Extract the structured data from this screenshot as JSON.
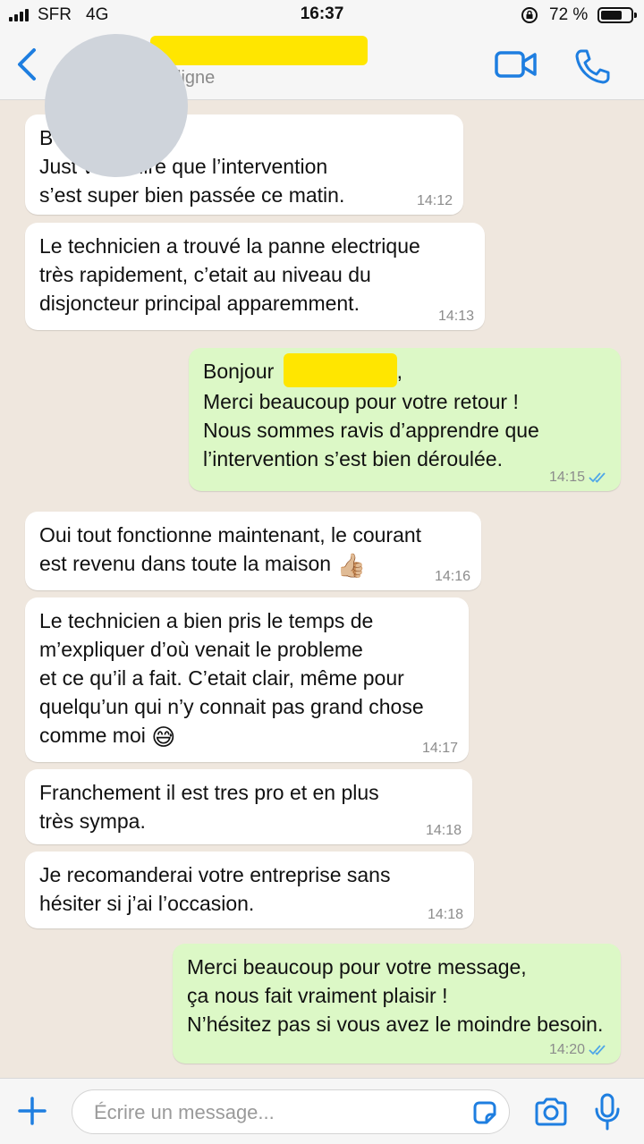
{
  "status_bar": {
    "carrier": "SFR",
    "network": "4G",
    "time": "16:37",
    "battery_percent": "72 %",
    "battery_level": 0.72
  },
  "header": {
    "contact_status": "ligne"
  },
  "messages": [
    {
      "direction": "in",
      "lines": [
        "B",
        "Just vous dire que l’intervention",
        "s’est super bien passée ce matin."
      ],
      "time": "14:12"
    },
    {
      "direction": "in",
      "lines": [
        "Le technicien a trouvé la panne electrique",
        "très rapidement, c’etait au niveau du",
        "disjoncteur principal apparemment."
      ],
      "time": "14:13"
    },
    {
      "direction": "out",
      "lines": [
        "Bonjour",
        ",",
        "Merci beaucoup pour votre retour !",
        "Nous sommes ravis d’apprendre que",
        "l’intervention s’est bien déroulée."
      ],
      "time": "14:15",
      "read": true
    },
    {
      "direction": "in",
      "lines": [
        "Oui tout fonctionne maintenant, le courant",
        "est revenu dans toute la maison"
      ],
      "emoji": "👍🏼",
      "time": "14:16"
    },
    {
      "direction": "in",
      "lines": [
        "Le technicien a bien pris le temps de",
        "m’expliquer d’où venait le probleme",
        "et ce qu’il a fait. C’etait clair, même pour",
        "quelqu’un qui n’y connait pas grand chose",
        "comme moi"
      ],
      "emoji": "😅",
      "time": "14:17"
    },
    {
      "direction": "in",
      "lines": [
        "Franchement il est tres pro et en plus",
        "très sympa."
      ],
      "time": "14:18"
    },
    {
      "direction": "in",
      "lines": [
        "Je recomanderai votre entreprise sans",
        "hésiter si j’ai l’occasion."
      ],
      "time": "14:18"
    },
    {
      "direction": "out",
      "lines": [
        "Merci beaucoup pour votre message,",
        "ça nous fait vraiment plaisir !",
        "N’hésitez pas si vous avez le moindre besoin."
      ],
      "time": "14:20",
      "read": true
    }
  ],
  "input": {
    "placeholder": "Écrire un message..."
  },
  "colors": {
    "accent": "#1e7ee0",
    "incoming_bubble": "#ffffff",
    "outgoing_bubble": "#dcf8c6",
    "read_ticks": "#4fa6e8",
    "chat_background": "#efe7de",
    "redaction": "#ffe600"
  },
  "icons": [
    "back-chevron-icon",
    "video-call-icon",
    "phone-call-icon",
    "plus-icon",
    "sticker-icon",
    "camera-icon",
    "microphone-icon",
    "read-ticks-icon",
    "orientation-lock-icon",
    "battery-icon",
    "signal-icon"
  ]
}
